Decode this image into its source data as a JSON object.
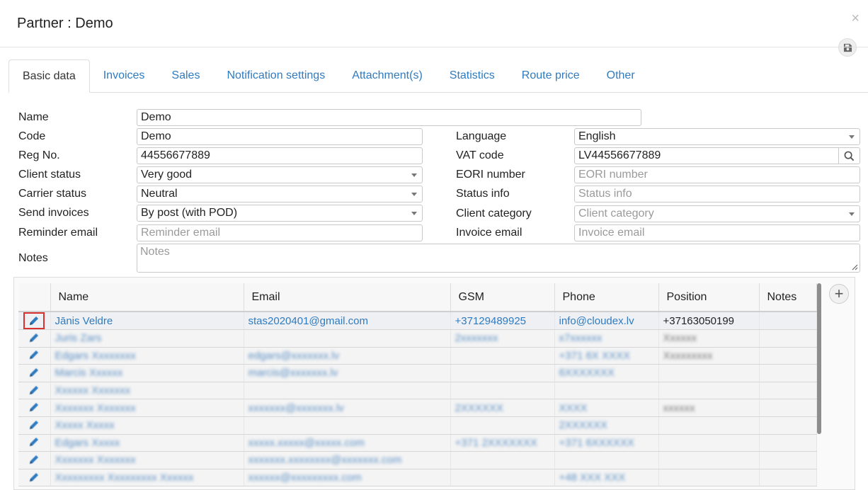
{
  "dialog": {
    "title": "Partner : Demo",
    "close_glyph": "×"
  },
  "tabs": [
    {
      "label": "Basic data"
    },
    {
      "label": "Invoices"
    },
    {
      "label": "Sales"
    },
    {
      "label": "Notification settings"
    },
    {
      "label": "Attachment(s)"
    },
    {
      "label": "Statistics"
    },
    {
      "label": "Route price"
    },
    {
      "label": "Other"
    }
  ],
  "form": {
    "name": {
      "label": "Name",
      "value": "Demo"
    },
    "code": {
      "label": "Code",
      "value": "Demo"
    },
    "reg_no": {
      "label": "Reg No.",
      "value": "44556677889"
    },
    "client_status": {
      "label": "Client status",
      "value": "Very good"
    },
    "carrier_status": {
      "label": "Carrier status",
      "value": "Neutral"
    },
    "send_invoices": {
      "label": "Send invoices",
      "value": "By post (with POD)"
    },
    "reminder_email": {
      "label": "Reminder email",
      "placeholder": "Reminder email"
    },
    "notes": {
      "label": "Notes",
      "placeholder": "Notes"
    },
    "language": {
      "label": "Language",
      "value": "English"
    },
    "vat_code": {
      "label": "VAT code",
      "value": "LV44556677889"
    },
    "eori_number": {
      "label": "EORI number",
      "placeholder": "EORI number"
    },
    "status_info": {
      "label": "Status info",
      "placeholder": "Status info"
    },
    "client_category": {
      "label": "Client category",
      "placeholder": "Client category"
    },
    "invoice_email": {
      "label": "Invoice email",
      "placeholder": "Invoice email"
    }
  },
  "contacts": {
    "columns": [
      "Name",
      "Email",
      "GSM",
      "Phone",
      "Position",
      "Notes"
    ],
    "first_row": {
      "name": "Jānis Veldre",
      "email": "stas2020401@gmail.com",
      "gsm": "+37129489925",
      "phone": "info@cloudex.lv",
      "position": "+37163050199",
      "notes": ""
    },
    "blurred_rows": [
      {
        "name": "Juris Zars",
        "email": "",
        "gsm": "2xxxxxxx",
        "phone": "x7xxxxxx",
        "position": "Xxxxxx"
      },
      {
        "name": "Edgars Xxxxxxxx",
        "email": "edgars@xxxxxxx.lv",
        "gsm": "",
        "phone": "+371 6X XXXX",
        "position": "Xxxxxxxxx"
      },
      {
        "name": "Marcis Xxxxxx",
        "email": "marcis@xxxxxxx.lv",
        "gsm": "",
        "phone": "6XXXXXXX",
        "position": ""
      },
      {
        "name": "Xxxxxx Xxxxxxx",
        "email": "",
        "gsm": "",
        "phone": "",
        "position": ""
      },
      {
        "name": "Xxxxxxx Xxxxxxx",
        "email": "xxxxxxx@xxxxxxx.lv",
        "gsm": "2XXXXXX",
        "phone": "XXXX",
        "position": "xxxxxx"
      },
      {
        "name": "Xxxxx Xxxxx",
        "email": "",
        "gsm": "",
        "phone": "2XXXXXX",
        "position": ""
      },
      {
        "name": "Edgars Xxxxx",
        "email": "xxxxx.xxxxx@xxxxx.com",
        "gsm": "+371 2XXXXXXX",
        "phone": "+371 6XXXXXX",
        "position": ""
      },
      {
        "name": "Xxxxxxx Xxxxxxx",
        "email": "xxxxxxx.xxxxxxxx@xxxxxxx.com",
        "gsm": "",
        "phone": "",
        "position": ""
      },
      {
        "name": "Xxxxxxxxx Xxxxxxxxx Xxxxxx",
        "email": "xxxxxx@xxxxxxxxx.com",
        "gsm": "",
        "phone": "+48 XXX XXX",
        "position": ""
      }
    ],
    "add_glyph": "+"
  },
  "colors": {
    "accent": "#2f7bbf",
    "highlight_border": "#d93030"
  }
}
